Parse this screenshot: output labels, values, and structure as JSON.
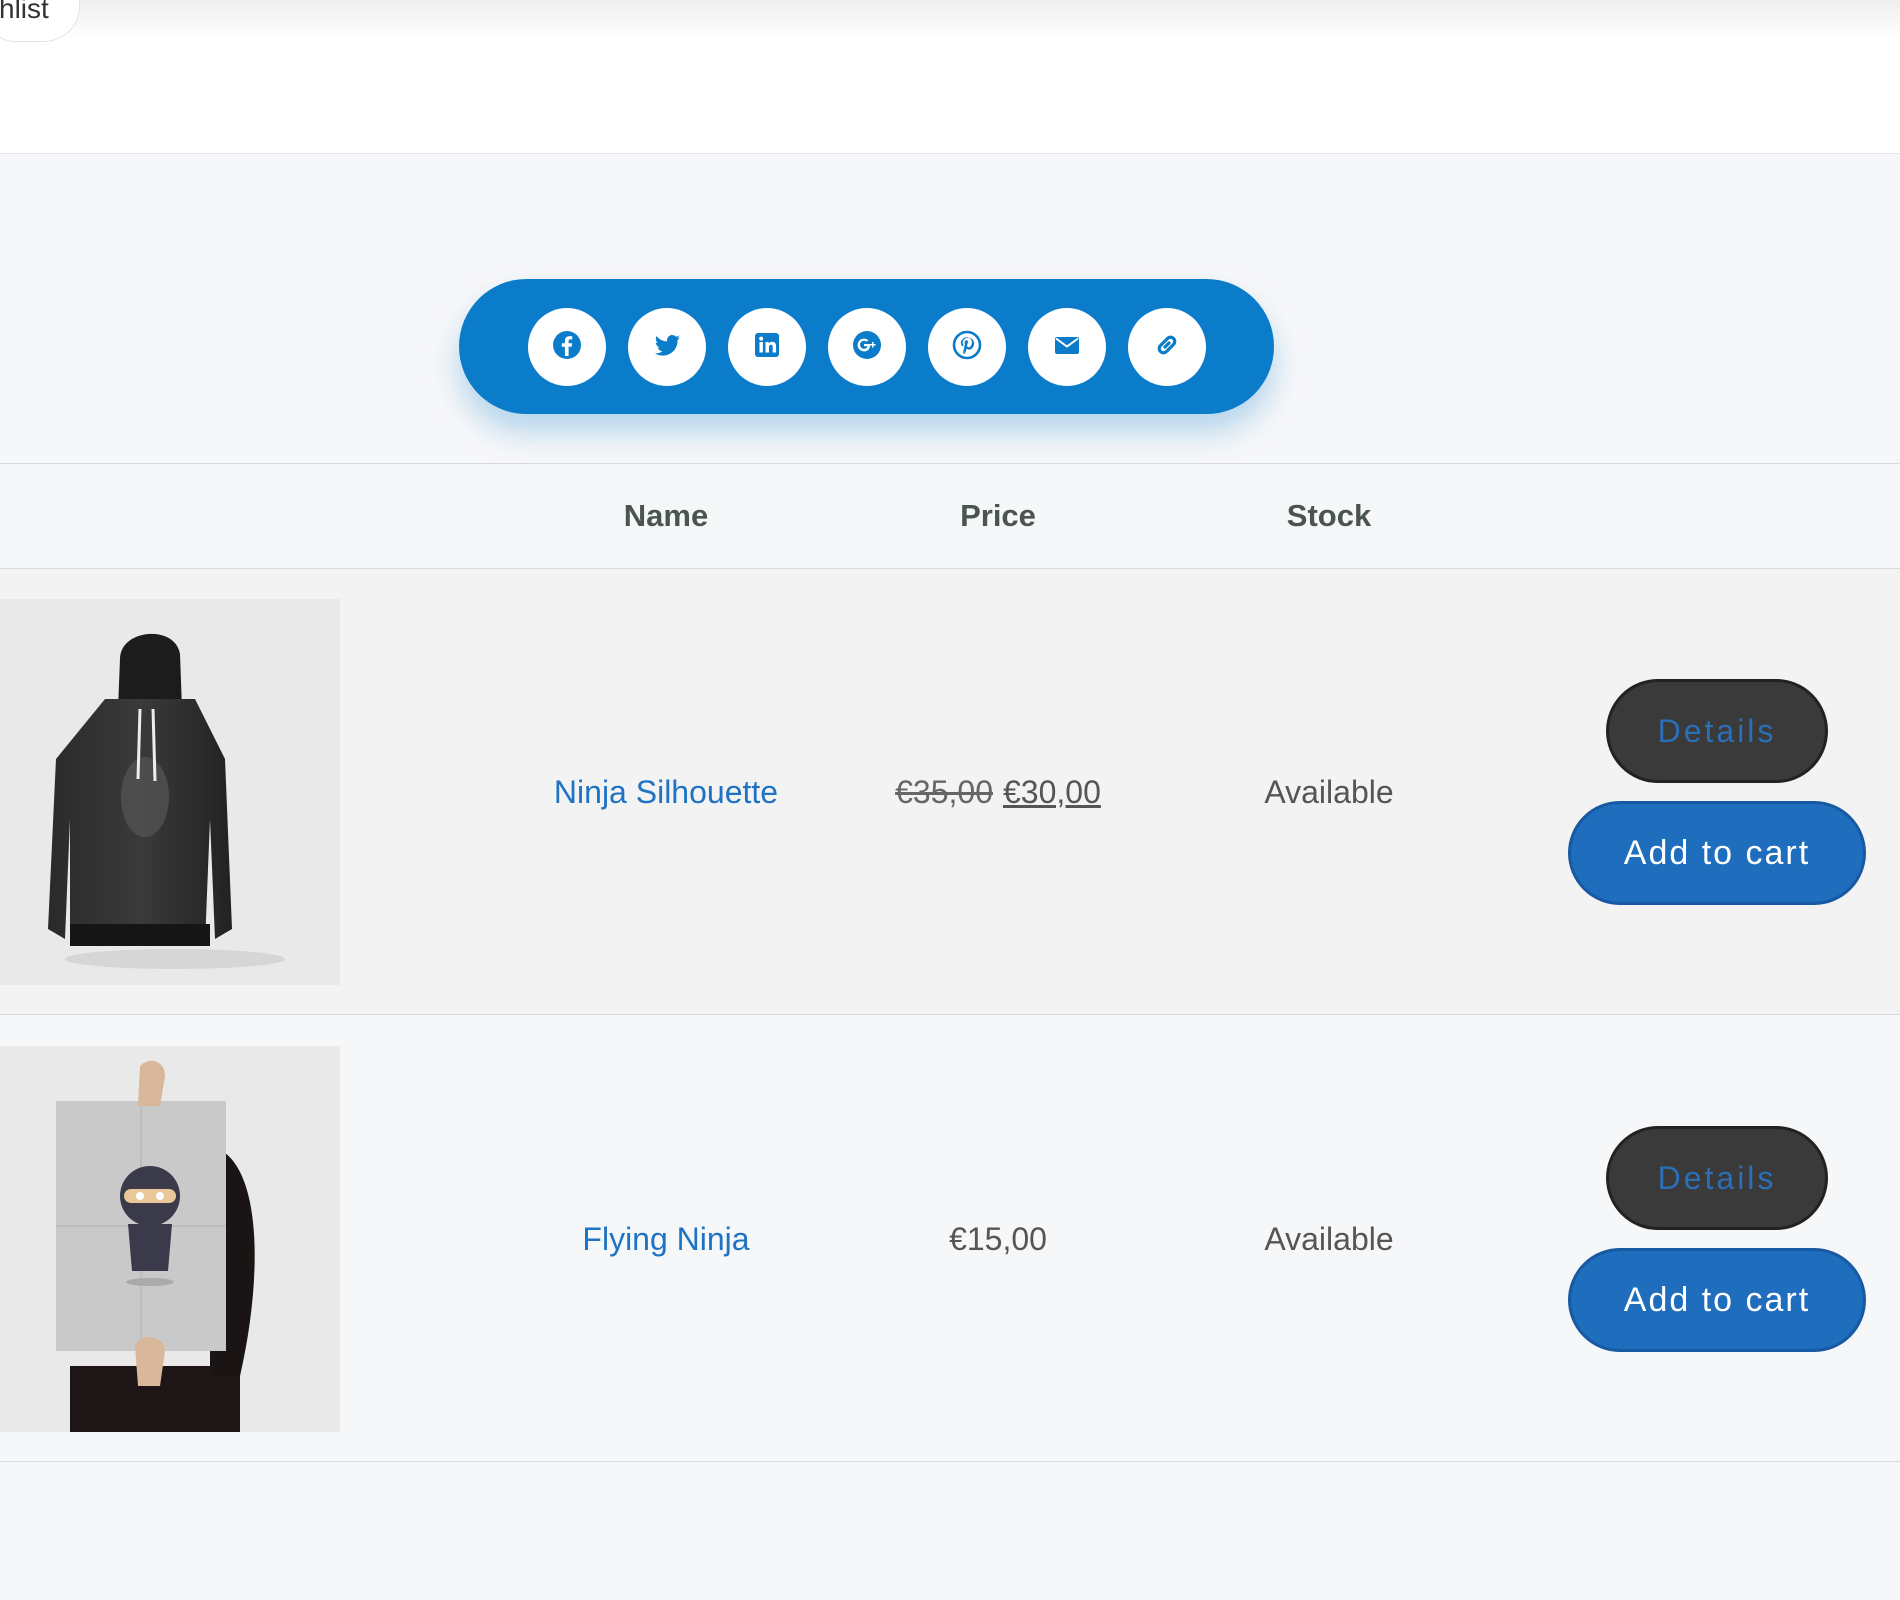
{
  "top": {
    "tab_label": "hlist"
  },
  "share": {
    "buttons": [
      {
        "icon": "facebook-icon"
      },
      {
        "icon": "twitter-icon"
      },
      {
        "icon": "linkedin-icon"
      },
      {
        "icon": "google-plus-icon"
      },
      {
        "icon": "pinterest-icon"
      },
      {
        "icon": "email-icon"
      },
      {
        "icon": "link-icon"
      }
    ],
    "accent": "#0a7cca"
  },
  "table": {
    "headers": {
      "name": "Name",
      "price": "Price",
      "stock": "Stock"
    },
    "rows": [
      {
        "name": "Ninja Silhouette",
        "price_old": "€35,00",
        "price_new": "€30,00",
        "price": "",
        "stock": "Available",
        "details_label": "Details",
        "cart_label": "Add to cart"
      },
      {
        "name": "Flying Ninja",
        "price_old": "",
        "price_new": "",
        "price": "€15,00",
        "stock": "Available",
        "details_label": "Details",
        "cart_label": "Add to cart"
      }
    ]
  }
}
